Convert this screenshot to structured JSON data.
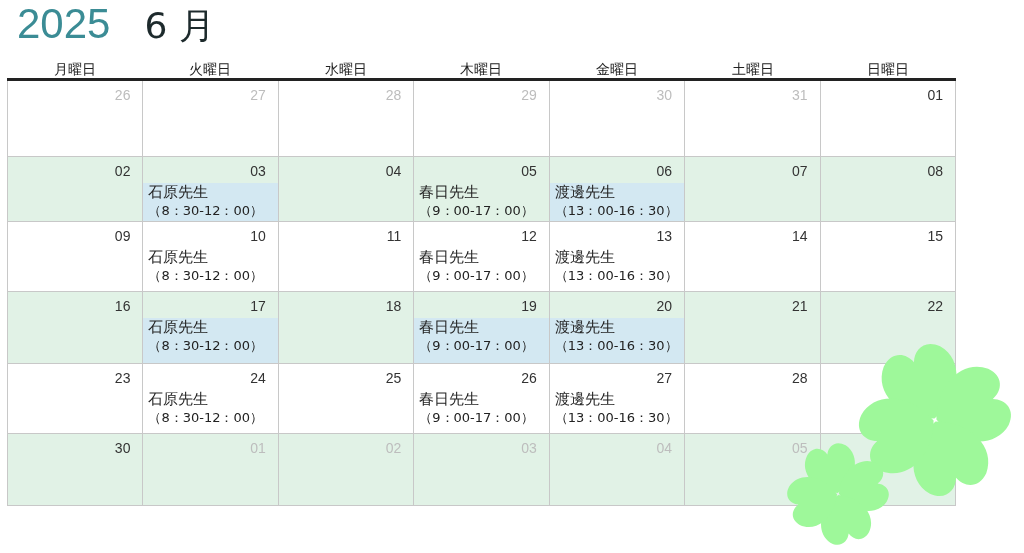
{
  "title": {
    "year": "2025",
    "month": "6 月"
  },
  "weekdays": [
    "月曜日",
    "火曜日",
    "水曜日",
    "木曜日",
    "金曜日",
    "土曜日",
    "日曜日"
  ],
  "weeks": [
    {
      "shaded": false,
      "days": [
        {
          "date": "26",
          "other_month": true
        },
        {
          "date": "27",
          "other_month": true
        },
        {
          "date": "28",
          "other_month": true
        },
        {
          "date": "29",
          "other_month": true
        },
        {
          "date": "30",
          "other_month": true
        },
        {
          "date": "31",
          "other_month": true
        },
        {
          "date": "01",
          "other_month": false
        }
      ]
    },
    {
      "shaded": true,
      "days": [
        {
          "date": "02",
          "other_month": false
        },
        {
          "date": "03",
          "other_month": false,
          "event": {
            "name": "石原先生",
            "time": "（8：30-12：00）",
            "highlighted": true
          }
        },
        {
          "date": "04",
          "other_month": false
        },
        {
          "date": "05",
          "other_month": false,
          "event": {
            "name": "春日先生",
            "time": "（9：00-17：00）",
            "highlighted": false
          }
        },
        {
          "date": "06",
          "other_month": false,
          "event": {
            "name": "渡邊先生",
            "time": "（13：00-16：30）",
            "highlighted": true
          }
        },
        {
          "date": "07",
          "other_month": false
        },
        {
          "date": "08",
          "other_month": false
        }
      ]
    },
    {
      "shaded": false,
      "days": [
        {
          "date": "09",
          "other_month": false
        },
        {
          "date": "10",
          "other_month": false,
          "event": {
            "name": "石原先生",
            "time": "（8：30-12：00）",
            "highlighted": false
          }
        },
        {
          "date": "11",
          "other_month": false
        },
        {
          "date": "12",
          "other_month": false,
          "event": {
            "name": "春日先生",
            "time": "（9：00-17：00）",
            "highlighted": false
          }
        },
        {
          "date": "13",
          "other_month": false,
          "event": {
            "name": "渡邊先生",
            "time": "（13：00-16：30）",
            "highlighted": false
          }
        },
        {
          "date": "14",
          "other_month": false
        },
        {
          "date": "15",
          "other_month": false
        }
      ]
    },
    {
      "shaded": true,
      "days": [
        {
          "date": "16",
          "other_month": false
        },
        {
          "date": "17",
          "other_month": false,
          "event": {
            "name": "石原先生",
            "time": "（8：30-12：00）",
            "highlighted": true
          }
        },
        {
          "date": "18",
          "other_month": false
        },
        {
          "date": "19",
          "other_month": false,
          "event": {
            "name": "春日先生",
            "time": "（9：00-17：00）",
            "highlighted": true
          }
        },
        {
          "date": "20",
          "other_month": false,
          "event": {
            "name": "渡邊先生",
            "time": "（13：00-16：30）",
            "highlighted": true
          }
        },
        {
          "date": "21",
          "other_month": false
        },
        {
          "date": "22",
          "other_month": false
        }
      ]
    },
    {
      "shaded": false,
      "days": [
        {
          "date": "23",
          "other_month": false
        },
        {
          "date": "24",
          "other_month": false,
          "event": {
            "name": "石原先生",
            "time": "（8：30-12：00）",
            "highlighted": false
          }
        },
        {
          "date": "25",
          "other_month": false
        },
        {
          "date": "26",
          "other_month": false,
          "event": {
            "name": "春日先生",
            "time": "（9：00-17：00）",
            "highlighted": false
          }
        },
        {
          "date": "27",
          "other_month": false,
          "event": {
            "name": "渡邊先生",
            "time": "（13：00-16：30）",
            "highlighted": false
          }
        },
        {
          "date": "28",
          "other_month": false
        }
      ]
    },
    {
      "shaded": true,
      "days": [
        {
          "date": "30",
          "other_month": false
        },
        {
          "date": "01",
          "other_month": true
        },
        {
          "date": "02",
          "other_month": true
        },
        {
          "date": "03",
          "other_month": true
        },
        {
          "date": "04",
          "other_month": true
        },
        {
          "date": "05",
          "other_month": true
        }
      ]
    }
  ]
}
